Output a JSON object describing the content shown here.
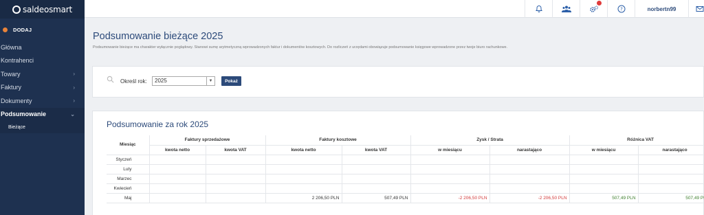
{
  "app": {
    "logo": "saldeosmart",
    "add_label": "DODAJ"
  },
  "sidebar": {
    "items": [
      {
        "label": "Główna",
        "has_children": false
      },
      {
        "label": "Kontrahenci",
        "has_children": false
      },
      {
        "label": "Towary",
        "has_children": true
      },
      {
        "label": "Faktury",
        "has_children": true
      },
      {
        "label": "Dokumenty",
        "has_children": true
      },
      {
        "label": "Podsumowanie",
        "has_children": true,
        "active": true
      }
    ],
    "subitems": [
      {
        "label": "Bieżące"
      }
    ]
  },
  "topbar": {
    "icons": [
      "bell-icon",
      "users-icon",
      "settings-icon",
      "help-icon",
      "mail-icon"
    ],
    "user": "norbertn99"
  },
  "header": {
    "title": "Podsumowanie bieżące 2025",
    "description": "Podsumowanie bieżące ma charakter wyłącznie poglądowy. Stanowi sumę arytmetyczną wprowadzonych faktur i dokumentów kosztowych. Do rozliczeń z urzędami obowiązuje podsumowanie księgowe wprowadzone przez twoje biuro rachunkowe."
  },
  "filter": {
    "label": "Określ rok:",
    "year": "2025",
    "button": "Pokaż"
  },
  "summary": {
    "title": "Podsumowanie za rok 2025",
    "columns": {
      "month": "Miesiąc",
      "sales": "Faktury sprzedażowe",
      "costs": "Faktury kosztowe",
      "profit": "Zysk / Strata",
      "vat": "Różnica VAT",
      "net": "kwota netto",
      "vat_amount": "kwota VAT",
      "in_month": "w miesiącu",
      "cumulative": "narastająco"
    },
    "rows": [
      {
        "month": "Styczeń",
        "sales_net": "",
        "sales_vat": "",
        "cost_net": "",
        "cost_vat": "",
        "profit_month": "",
        "profit_cum": "",
        "vat_month": "",
        "vat_cum": ""
      },
      {
        "month": "Luty",
        "sales_net": "",
        "sales_vat": "",
        "cost_net": "",
        "cost_vat": "",
        "profit_month": "",
        "profit_cum": "",
        "vat_month": "",
        "vat_cum": ""
      },
      {
        "month": "Marzec",
        "sales_net": "",
        "sales_vat": "",
        "cost_net": "",
        "cost_vat": "",
        "profit_month": "",
        "profit_cum": "",
        "vat_month": "",
        "vat_cum": ""
      },
      {
        "month": "Kwiecień",
        "sales_net": "",
        "sales_vat": "",
        "cost_net": "",
        "cost_vat": "",
        "profit_month": "",
        "profit_cum": "",
        "vat_month": "",
        "vat_cum": ""
      },
      {
        "month": "Maj",
        "sales_net": "",
        "sales_vat": "",
        "cost_net": "2 206,50 PLN",
        "cost_vat": "507,49 PLN",
        "profit_month": "-2 206,50 PLN",
        "profit_cum": "-2 206,50 PLN",
        "vat_month": "507,49 PLN",
        "vat_cum": "507,49 PLN"
      }
    ]
  },
  "colors": {
    "sidebar": "#1e3150",
    "accent": "#2c4a7a",
    "negative": "#d23a3a",
    "positive": "#3e7f2d",
    "add_dot": "#e8833a"
  }
}
